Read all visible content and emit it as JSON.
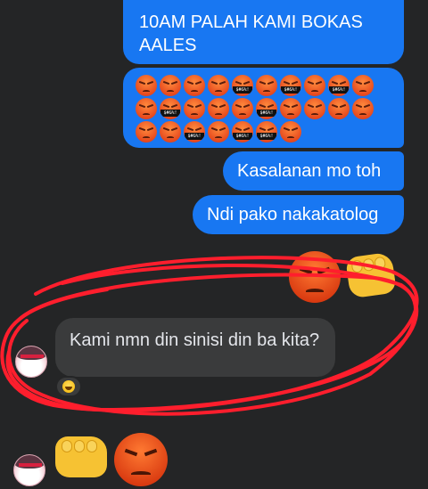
{
  "messages_out": [
    {
      "text": "10AM PALAH KAMI BOKAS AALES"
    },
    {
      "emoji_grid": {
        "count": 27,
        "emoji": "angry-face",
        "cursing_positions": [
          4,
          6,
          8,
          11,
          15,
          22,
          24,
          25
        ]
      }
    },
    {
      "text": "Kasalanan mo toh"
    },
    {
      "text": "Ndi pako nakakatolog"
    }
  ],
  "message_in": {
    "text": "Kami nmn din sinisi din ba kita?",
    "reaction": "laughing-face"
  },
  "cursing_label": "$#&%!",
  "stickers": [
    "angry-face",
    "oncoming-fist"
  ],
  "colors": {
    "background": "#242526",
    "outgoing_bubble": "#1877f2",
    "incoming_bubble": "#3a3b3c",
    "scribble": "#ff1e2d"
  }
}
